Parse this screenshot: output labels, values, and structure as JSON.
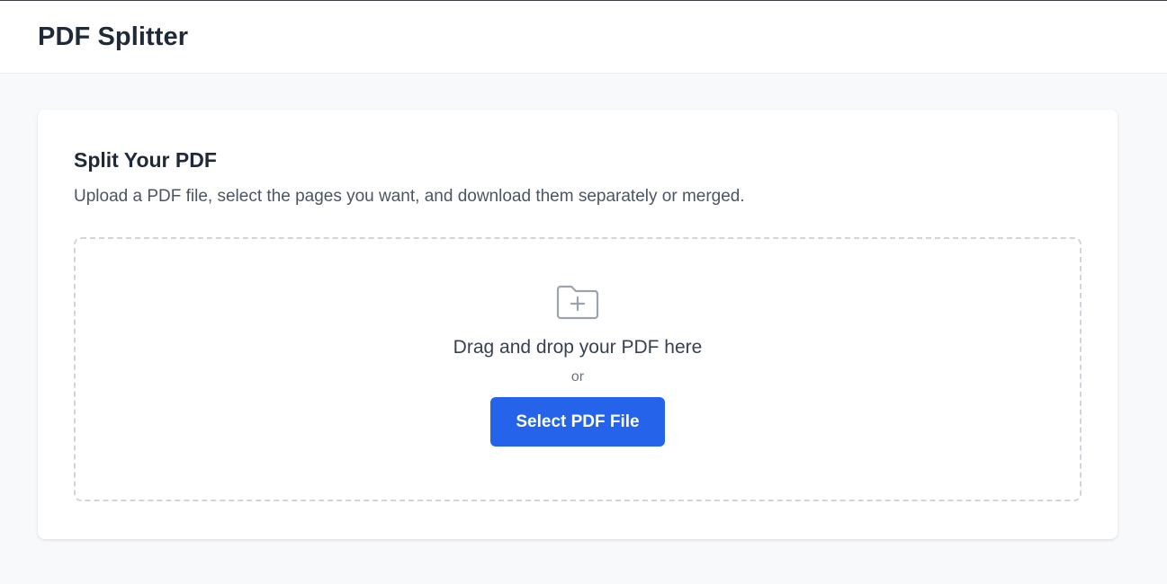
{
  "header": {
    "title": "PDF Splitter"
  },
  "card": {
    "title": "Split Your PDF",
    "description": "Upload a PDF file, select the pages you want, and download them separately or merged."
  },
  "dropzone": {
    "icon": "folder-plus-icon",
    "prompt": "Drag and drop your PDF here",
    "separator": "or",
    "button_label": "Select PDF File"
  },
  "colors": {
    "accent": "#2563eb",
    "background": "#f8f9fb",
    "card": "#ffffff",
    "dropzone_border": "#d1d5db",
    "icon": "#9ca3af"
  }
}
